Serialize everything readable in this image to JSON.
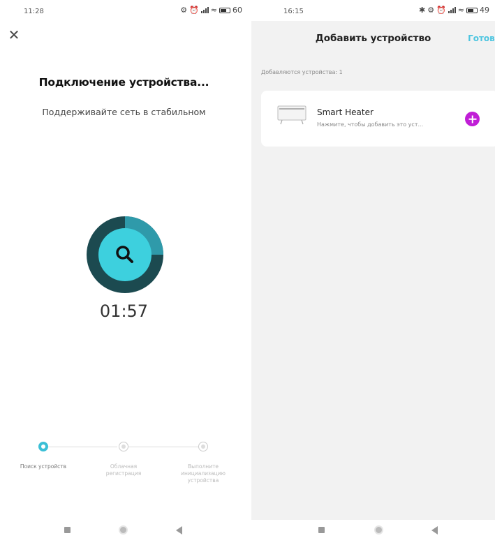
{
  "left": {
    "status": {
      "time": "11:28",
      "battery": "60"
    },
    "close_icon": "close-icon",
    "title": "Подключение устройства...",
    "subtitle": "Поддерживайте сеть в стабильном",
    "search_icon": "search-icon",
    "timer": "01:57",
    "progress_fraction": 0.25,
    "steps": [
      {
        "label": "Поиск устройств",
        "active": true
      },
      {
        "label": "Облачная регистрация",
        "active": false
      },
      {
        "label": "Выполните инициализацию устройства",
        "active": false
      }
    ]
  },
  "right": {
    "status": {
      "time": "16:15",
      "battery": "49"
    },
    "title": "Добавить устройство",
    "done_label": "Готово",
    "adding_label": "Добавляются устройства: 1",
    "device": {
      "name": "Smart Heater",
      "hint": "Нажмите, чтобы добавить это уст...",
      "add_icon": "plus-icon"
    }
  },
  "colors": {
    "accent_cyan": "#3bbfd6",
    "ring_dark": "#1c4a50",
    "ring_mid": "#2f9aaa",
    "add_purple": "#c01ed6",
    "done_blue": "#4cc5e0"
  }
}
